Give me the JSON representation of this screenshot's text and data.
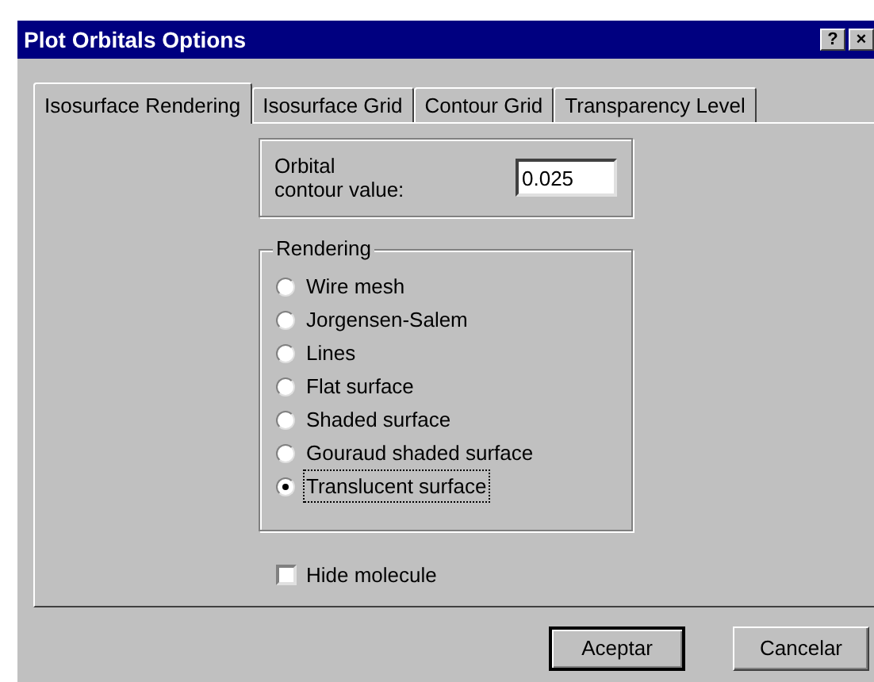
{
  "window": {
    "title": "Plot Orbitals Options",
    "buttons": [
      "?",
      "×"
    ]
  },
  "tabs": [
    {
      "label": "Isosurface Rendering",
      "selected": true
    },
    {
      "label": "Isosurface Grid",
      "selected": false
    },
    {
      "label": "Contour Grid",
      "selected": false
    },
    {
      "label": "Transparency Level",
      "selected": false
    }
  ],
  "contour": {
    "label_lines": [
      "Orbital",
      "contour value:"
    ],
    "value": "0.025"
  },
  "rendering": {
    "title": "Rendering",
    "options": [
      {
        "label": "Wire mesh",
        "selected": false
      },
      {
        "label": "Jorgensen-Salem",
        "selected": false
      },
      {
        "label": "Lines",
        "selected": false
      },
      {
        "label": "Flat surface",
        "selected": false
      },
      {
        "label": "Shaded surface",
        "selected": false
      },
      {
        "label": "Gouraud shaded surface",
        "selected": false
      },
      {
        "label": "Translucent surface",
        "selected": true
      }
    ]
  },
  "hide_molecule": {
    "label": "Hide molecule",
    "checked": false
  },
  "buttons": [
    {
      "label": "Aceptar",
      "default": true
    },
    {
      "label": "Cancelar",
      "default": false
    }
  ]
}
